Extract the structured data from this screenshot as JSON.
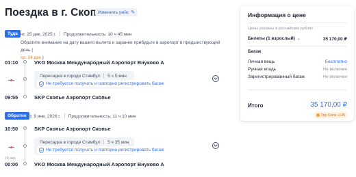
{
  "header": {
    "title": "Поездка в г. Скопье",
    "edit_label": "Изменить рейс"
  },
  "outbound": {
    "badge": "Туда",
    "date": "чт, 25 дек. 2025 г.",
    "duration": "Продолжительность: 10 ч 45 мин",
    "notice_text": "Обратите внимание на дату вашего вылета и заранее прибудьте в аэропорт в предшествующий день (",
    "notice_date": "ср, 24 дек.",
    "notice_end": ")",
    "dep_time": "01:10",
    "dep_airport": "VKO Москва Международный Аэропорт Внуково А",
    "transfer": "Пересадка в городе Стамбул",
    "transfer_time": "5 ч 5 мин",
    "baggage_note": "Не требуется получать и повторно регистрировать багаж",
    "arr_time": "09:55",
    "arr_airport": "SKP Скопье Аэропорт Скопье"
  },
  "return": {
    "badge": "Обратно",
    "date": "пт, 9 янв. 2026 г.",
    "duration": "Продолжительность: 11 ч 10 мин",
    "dep_time": "10:50",
    "dep_airport": "SKP Скопье Аэропорт Скопье",
    "transfer": "Пересадка в городе Стамбул",
    "transfer_time": "5 ч 35 мин",
    "baggage_note": "Не требуется получать и повторно регистрировать багаж",
    "arr_date_small": "10 янв.",
    "arr_time": "00:00",
    "arr_airport": "VKO Москва Международный Аэропорт Внуково А"
  },
  "price": {
    "title": "Информация о цене",
    "subtitle": "Цены указаны в российских рублях",
    "tickets_label": "Билеты (1 взрослый)",
    "tickets_value": "35 170,00 ₽",
    "baggage_header": "Багаж",
    "rows": [
      {
        "label": "Личная вещь",
        "value": "Бесплатно"
      },
      {
        "label": "Ручная кладь",
        "value": "Не включен"
      },
      {
        "label": "Зарегистрированный багаж",
        "value": "Не включен"
      }
    ],
    "total_label": "Итого",
    "total_value": "35 170,00 ₽",
    "coins": "Trip Coins +145"
  },
  "colors": {
    "accent": "#2f6fe4",
    "free": "#2f6fe4",
    "warning": "#e0781f"
  }
}
